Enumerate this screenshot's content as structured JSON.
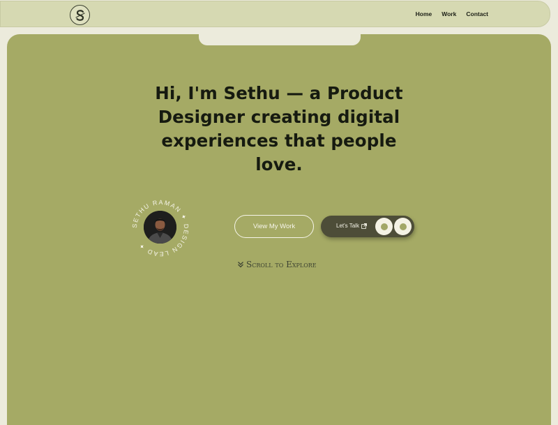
{
  "nav": {
    "logo_icon": "s-monogram-logo",
    "links": [
      "Home",
      "Work",
      "Contact"
    ]
  },
  "hero": {
    "headline": "Hi, I'm Sethu — a Product Designer creating digital experiences that people love.",
    "badge_text": "SETHU RAMAN ✦ DESIGN LEAD ✦",
    "primary_button": "View My Work",
    "secondary_button": "Let's Talk",
    "secondary_icon": "external-link-icon",
    "scroll_label": "Scroll to Explore",
    "scroll_icon": "double-chevron-down-icon"
  },
  "colors": {
    "nav_bg": "#d6d9b2",
    "panel_bg": "#a5aa65",
    "page_bg": "#ecebdc",
    "dark_button": "#4d4d38",
    "text_dark": "#161a10",
    "light": "#f6f5ea"
  }
}
